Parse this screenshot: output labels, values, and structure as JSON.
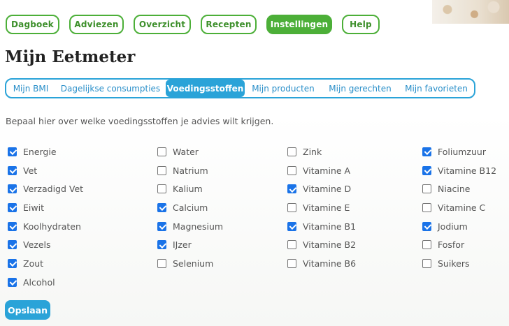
{
  "nav": {
    "items": [
      {
        "label": "Dagboek",
        "active": false
      },
      {
        "label": "Adviezen",
        "active": false
      },
      {
        "label": "Overzicht",
        "active": false
      },
      {
        "label": "Recepten",
        "active": false
      },
      {
        "label": "Instellingen",
        "active": true
      },
      {
        "label": "Help",
        "active": false
      }
    ]
  },
  "page": {
    "title": "Mijn Eetmeter",
    "intro": "Bepaal hier over welke voedingsstoffen je advies wilt krijgen.",
    "save_label": "Opslaan"
  },
  "tabs": [
    {
      "label": "Mijn BMI",
      "active": false
    },
    {
      "label": "Dagelijkse consumpties",
      "active": false
    },
    {
      "label": "Voedingsstoffen",
      "active": true
    },
    {
      "label": "Mijn producten",
      "active": false
    },
    {
      "label": "Mijn gerechten",
      "active": false
    },
    {
      "label": "Mijn favorieten",
      "active": false
    }
  ],
  "nutrients": {
    "columns": [
      [
        {
          "label": "Energie",
          "checked": true
        },
        {
          "label": "Vet",
          "checked": true
        },
        {
          "label": "Verzadigd Vet",
          "checked": true
        },
        {
          "label": "Eiwit",
          "checked": true
        },
        {
          "label": "Koolhydraten",
          "checked": true
        },
        {
          "label": "Vezels",
          "checked": true
        },
        {
          "label": "Zout",
          "checked": true
        },
        {
          "label": "Alcohol",
          "checked": true
        }
      ],
      [
        {
          "label": "Water",
          "checked": false
        },
        {
          "label": "Natrium",
          "checked": false
        },
        {
          "label": "Kalium",
          "checked": false
        },
        {
          "label": "Calcium",
          "checked": true
        },
        {
          "label": "Magnesium",
          "checked": true
        },
        {
          "label": "IJzer",
          "checked": true
        },
        {
          "label": "Selenium",
          "checked": false
        }
      ],
      [
        {
          "label": "Zink",
          "checked": false
        },
        {
          "label": "Vitamine A",
          "checked": false
        },
        {
          "label": "Vitamine D",
          "checked": true
        },
        {
          "label": "Vitamine E",
          "checked": false
        },
        {
          "label": "Vitamine B1",
          "checked": true
        },
        {
          "label": "Vitamine B2",
          "checked": false
        },
        {
          "label": "Vitamine B6",
          "checked": false
        }
      ],
      [
        {
          "label": "Foliumzuur",
          "checked": true
        },
        {
          "label": "Vitamine B12",
          "checked": true
        },
        {
          "label": "Niacine",
          "checked": false
        },
        {
          "label": "Vitamine C",
          "checked": false
        },
        {
          "label": "Jodium",
          "checked": true
        },
        {
          "label": "Fosfor",
          "checked": false
        },
        {
          "label": "Suikers",
          "checked": false
        }
      ]
    ]
  }
}
